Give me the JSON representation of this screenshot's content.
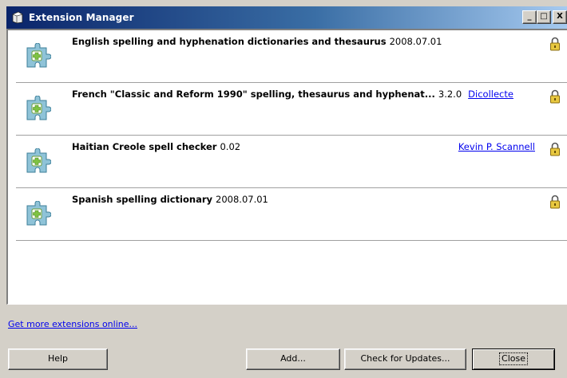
{
  "window": {
    "title": "Extension Manager",
    "controls": {
      "minimize": "_",
      "maximize": "□",
      "close": "X"
    }
  },
  "extensions": [
    {
      "name": "English spelling and hyphenation dictionaries and thesaurus",
      "version": "2008.07.01",
      "author": "",
      "icon": "puzzle-piece-icon",
      "locked": true
    },
    {
      "name": "French \"Classic and Reform 1990\" spelling, thesaurus and hyphenat...",
      "version": "3.2.0",
      "author": "Dicollecte",
      "icon": "puzzle-piece-icon",
      "locked": true
    },
    {
      "name": "Haitian Creole spell checker",
      "version": "0.02",
      "author": "Kevin P. Scannell",
      "icon": "puzzle-piece-icon",
      "locked": true
    },
    {
      "name": "Spanish spelling dictionary",
      "version": "2008.07.01",
      "author": "",
      "icon": "puzzle-piece-icon",
      "locked": true
    }
  ],
  "links": {
    "get_more": "Get more extensions online..."
  },
  "buttons": {
    "help": "Help",
    "add": "Add...",
    "check_updates": "Check for Updates...",
    "close": "Close"
  },
  "colors": {
    "titlebar_start": "#0a246a",
    "titlebar_end": "#a6caf0",
    "link": "#0000ee",
    "dialog_bg": "#d4d0c8"
  }
}
